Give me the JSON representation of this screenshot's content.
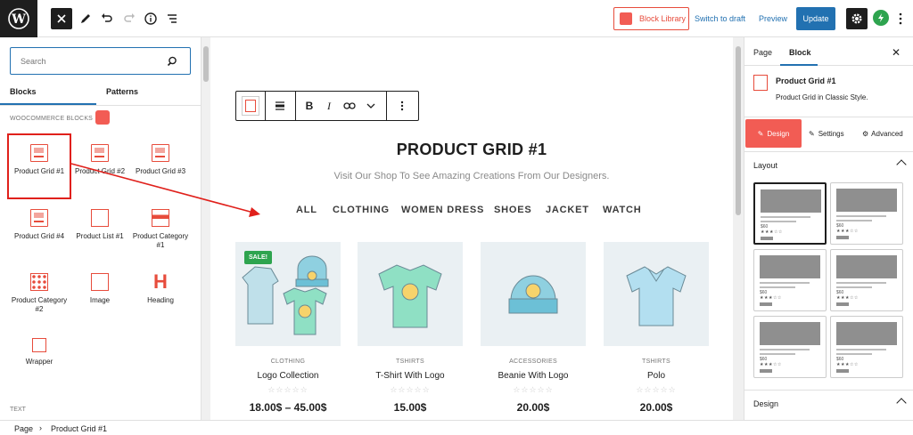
{
  "toolbar": {
    "block_library": "Block Library",
    "switch_to_draft": "Switch to draft",
    "preview": "Preview",
    "update": "Update"
  },
  "inserter": {
    "search_placeholder": "Search",
    "tabs": [
      "Blocks",
      "Patterns"
    ],
    "category_woo": "WOOCOMMERCE BLOCKS",
    "category_text": "TEXT",
    "blocks": [
      {
        "label": "Product Grid #1"
      },
      {
        "label": "Product Grid #2"
      },
      {
        "label": "Product Grid #3"
      },
      {
        "label": "Product Grid #4"
      },
      {
        "label": "Product List #1"
      },
      {
        "label": "Product Category #1"
      },
      {
        "label": "Product Category #2"
      },
      {
        "label": "Image"
      },
      {
        "label": "Heading"
      },
      {
        "label": "Wrapper"
      }
    ]
  },
  "canvas": {
    "title": "PRODUCT GRID #1",
    "subtitle": "Visit Our Shop To See Amazing Creations From Our Designers.",
    "filters": [
      "ALL",
      "CLOTHING",
      "WOMEN DRESS",
      "SHOES",
      "JACKET",
      "WATCH"
    ],
    "sale_badge": "SALE!",
    "products": [
      {
        "category": "CLOTHING",
        "name": "Logo Collection",
        "stars": "☆☆☆☆☆",
        "price": "18.00$ – 45.00$"
      },
      {
        "category": "TSHIRTS",
        "name": "T-Shirt With Logo",
        "stars": "☆☆☆☆☆",
        "price": "15.00$"
      },
      {
        "category": "ACCESSORIES",
        "name": "Beanie With Logo",
        "stars": "☆☆☆☆☆",
        "price": "20.00$"
      },
      {
        "category": "TSHIRTS",
        "name": "Polo",
        "stars": "☆☆☆☆☆",
        "price": "20.00$"
      }
    ]
  },
  "sidebar": {
    "tabs": [
      "Page",
      "Block"
    ],
    "block_title": "Product Grid #1",
    "block_desc": "Product Grid in Classic Style.",
    "segments": [
      "Design",
      "Settings",
      "Advanced"
    ],
    "layout_label": "Layout",
    "design_label": "Design",
    "thumb_price": "$60",
    "thumb_stars": "★★★☆☆"
  },
  "statusbar": {
    "crumbs": [
      "Page",
      "Product Grid #1"
    ]
  },
  "colors": {
    "accent": "#2271b1",
    "brand_red": "#f25c54",
    "sale_green": "#2ea44f"
  }
}
